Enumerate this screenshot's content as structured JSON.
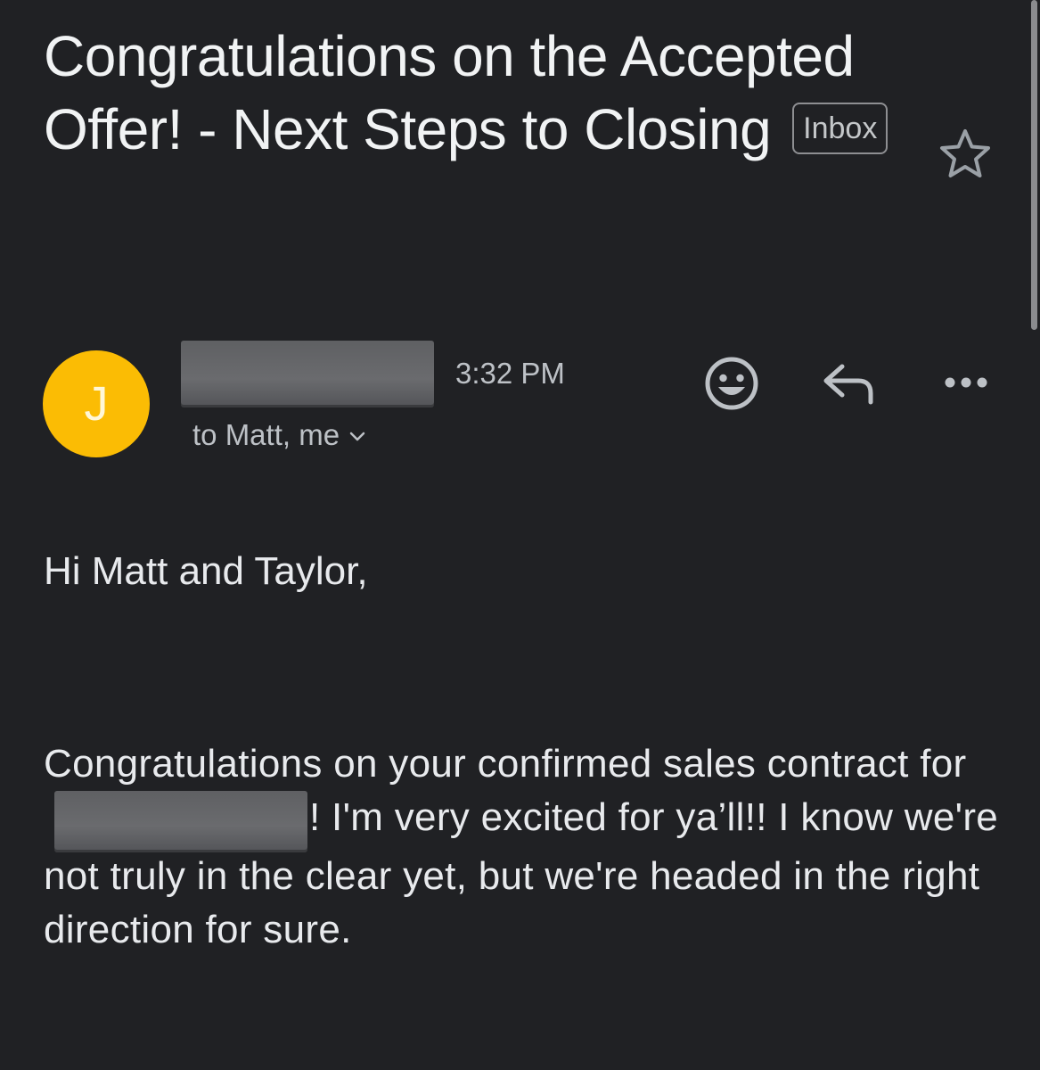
{
  "email": {
    "subject": "Congratulations on the Accepted Offer! - Next Steps to Closing",
    "label": "Inbox",
    "sender_initial": "J",
    "time": "3:32 PM",
    "recipients": "to Matt, me",
    "greeting": "Hi Matt and Taylor,",
    "body": {
      "before_redaction": "Congratulations on your confirmed sales contract for",
      "after_redaction": "! I'm very excited for ya’ll!! I know we're not truly in the clear yet, but we're headed in the right direction for sure."
    }
  },
  "icons": {
    "star": "star-outline-icon",
    "emoji": "add-reaction-icon",
    "reply": "reply-icon",
    "more": "more-horizontal-icon",
    "expand": "chevron-down-icon"
  },
  "colors": {
    "background": "#202124",
    "avatar": "#fbbc04",
    "text": "#e8eaed",
    "secondary_text": "#bdc1c6",
    "redaction": "#636467"
  }
}
